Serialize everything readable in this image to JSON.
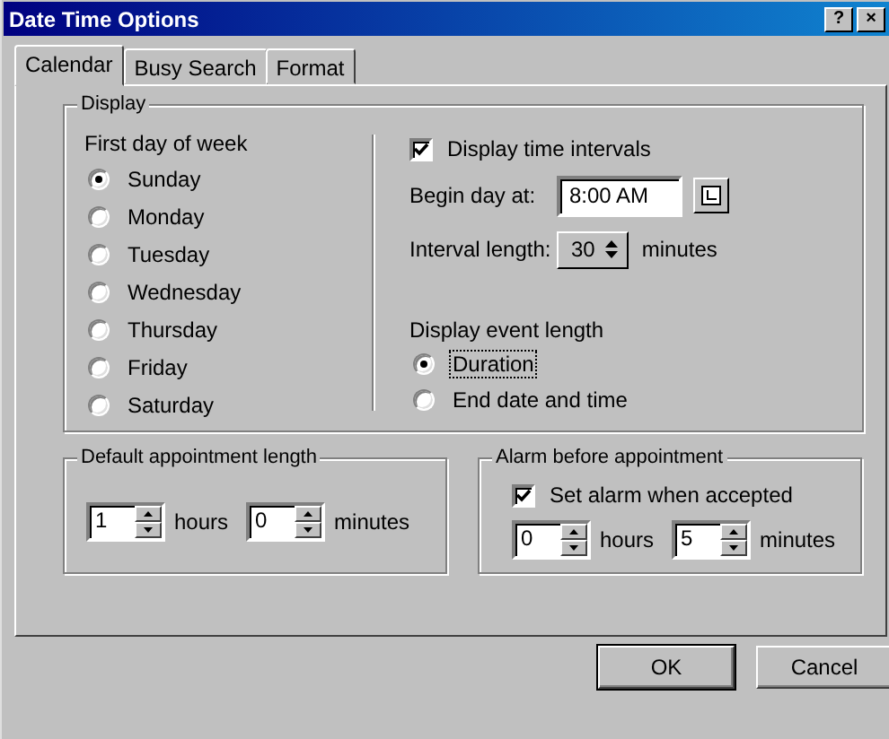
{
  "window": {
    "title": "Date Time Options",
    "title_buttons": [
      "?",
      "×"
    ]
  },
  "tabs": [
    {
      "label": "Calendar",
      "selected": true
    },
    {
      "label": "Busy Search",
      "selected": false
    },
    {
      "label": "Format",
      "selected": false
    }
  ],
  "display": {
    "title": "Display",
    "first_day": {
      "label": "First day of week",
      "options": [
        {
          "label": "Sunday",
          "selected": true
        },
        {
          "label": "Monday",
          "selected": false
        },
        {
          "label": "Tuesday",
          "selected": false
        },
        {
          "label": "Wednesday",
          "selected": false
        },
        {
          "label": "Thursday",
          "selected": false
        },
        {
          "label": "Friday",
          "selected": false
        },
        {
          "label": "Saturday",
          "selected": false
        }
      ]
    },
    "time_intervals": {
      "label": "Display time intervals",
      "checked": true
    },
    "begin_day": {
      "label": "Begin day at:",
      "value": "8:00 AM"
    },
    "interval": {
      "label": "Interval length:",
      "value": "30",
      "unit": "minutes"
    },
    "event_length": {
      "label": "Display event length",
      "options": [
        {
          "label": "Duration",
          "selected": true,
          "focused": true
        },
        {
          "label": "End date and time",
          "selected": false,
          "focused": false
        }
      ]
    }
  },
  "default_length": {
    "title": "Default appointment length",
    "fields": [
      {
        "value": "1",
        "unit": "hours"
      },
      {
        "value": "0",
        "unit": "minutes"
      }
    ]
  },
  "alarm": {
    "title": "Alarm before appointment",
    "checkbox": {
      "label": "Set alarm when accepted",
      "checked": true
    },
    "fields": [
      {
        "value": "0",
        "unit": "hours"
      },
      {
        "value": "5",
        "unit": "minutes"
      }
    ]
  },
  "buttons": [
    {
      "label": "OK",
      "default": true
    },
    {
      "label": "Cancel",
      "default": false
    }
  ]
}
